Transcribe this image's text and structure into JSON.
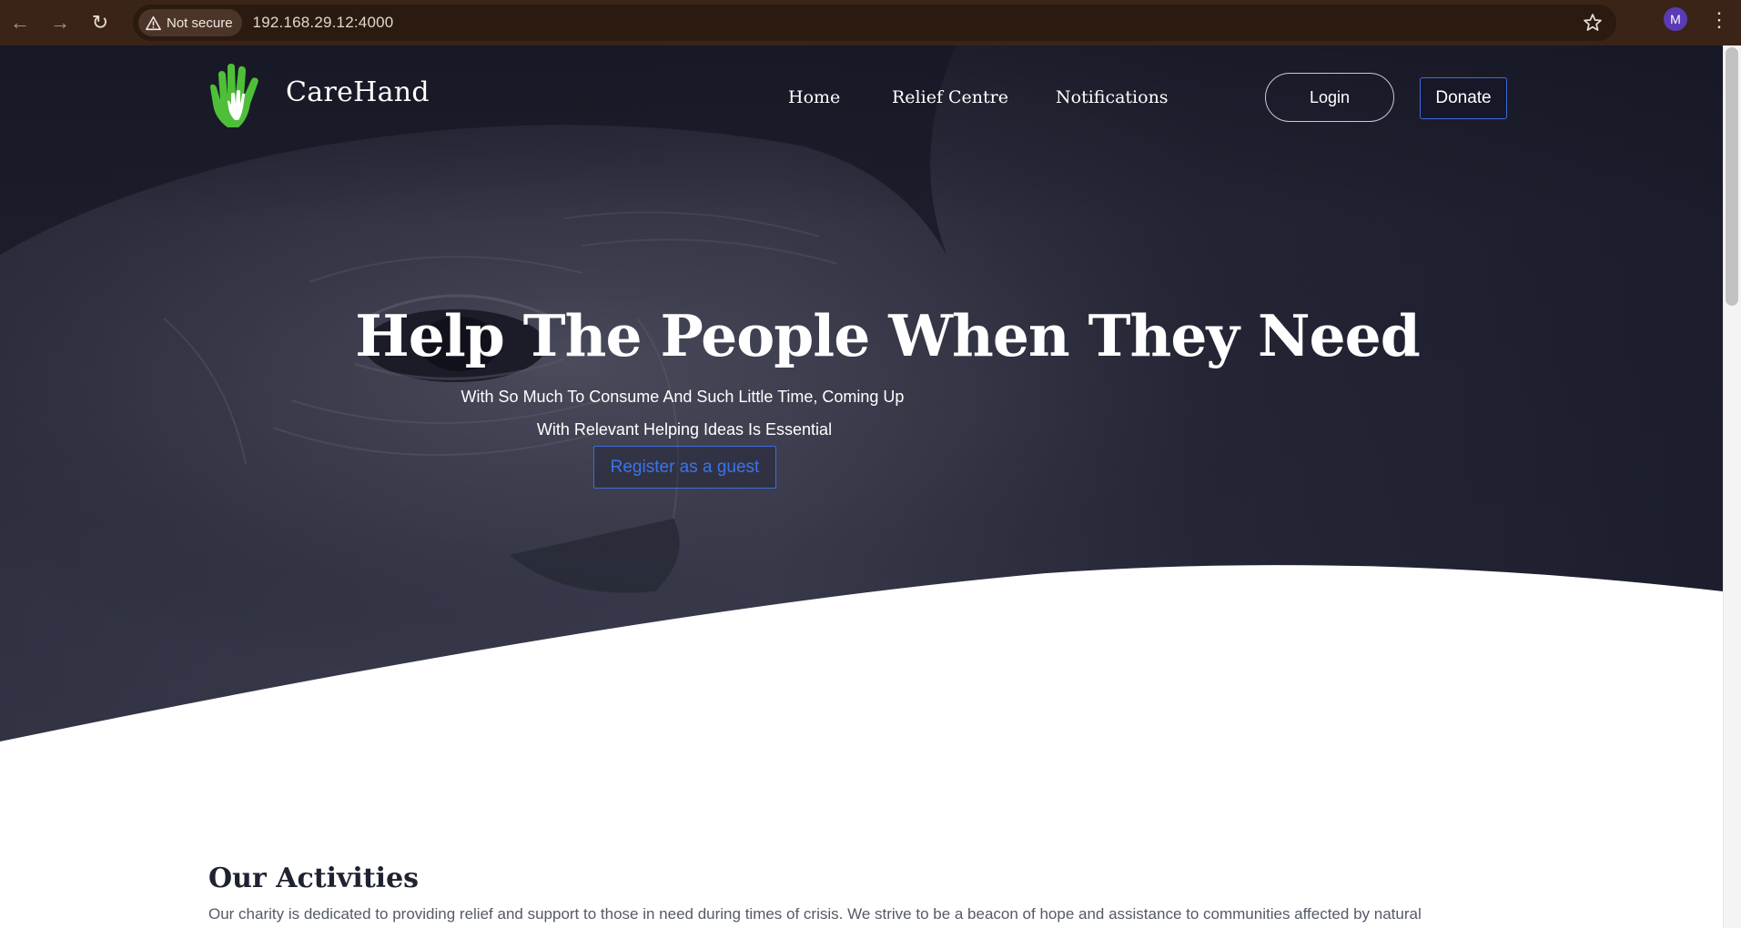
{
  "browser": {
    "security_label": "Not secure",
    "url": "192.168.29.12:4000",
    "profile_initial": "M"
  },
  "site": {
    "name": "CareHand",
    "colors": {
      "logo_green": "#4fbf3a",
      "accent_blue": "#3f6cd8",
      "hero_overlay": "#1c1e30"
    }
  },
  "nav": {
    "items": [
      {
        "label": "Home"
      },
      {
        "label": "Relief Centre"
      },
      {
        "label": "Notifications"
      }
    ],
    "login_label": "Login",
    "donate_label": "Donate"
  },
  "hero": {
    "title": "Help The People When They Need",
    "subtitle_line1": "With So Much To Consume And Such Little Time, Coming Up",
    "subtitle_line2": "With Relevant Helping Ideas Is Essential",
    "cta_label": "Register as a guest"
  },
  "activities": {
    "title": "Our Activities",
    "text": "Our charity is dedicated to providing relief and support to those in need during times of crisis. We strive to be a beacon of hope and assistance to communities affected by natural"
  }
}
